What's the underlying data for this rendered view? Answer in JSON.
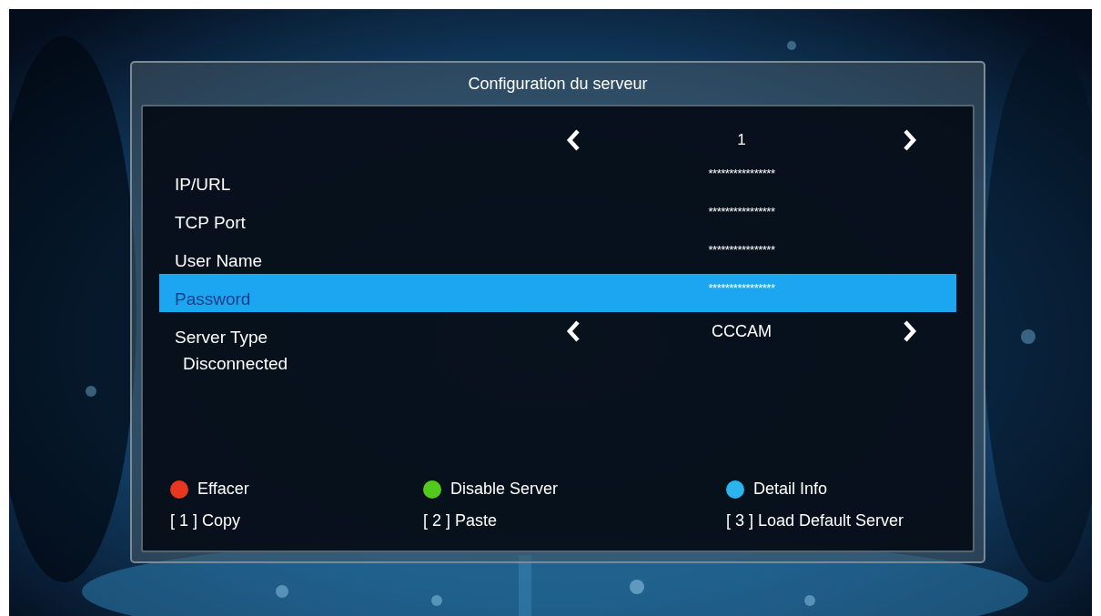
{
  "title": "Configuration du serveur",
  "server_number": {
    "value": "1"
  },
  "fields": [
    {
      "kind": "text",
      "label": "IP/URL",
      "value": "****************",
      "selected": false
    },
    {
      "kind": "text",
      "label": "TCP Port",
      "value": "****************",
      "selected": false
    },
    {
      "kind": "text",
      "label": "User Name",
      "value": "****************",
      "selected": false
    },
    {
      "kind": "text",
      "label": "Password",
      "value": "****************",
      "selected": true
    },
    {
      "kind": "choice",
      "label": "Server Type",
      "value": "CCCAM",
      "selected": false
    }
  ],
  "status": "Disconnected",
  "color_keys": [
    {
      "label": "Effacer",
      "color": "#e8361f"
    },
    {
      "label": "Disable Server",
      "color": "#52c91c"
    },
    {
      "label": "Detail Info",
      "color": "#2bb5ee"
    }
  ],
  "number_keys": [
    "[ 1 ] Copy",
    "[ 2 ] Paste",
    "[ 3 ] Load Default Server"
  ]
}
